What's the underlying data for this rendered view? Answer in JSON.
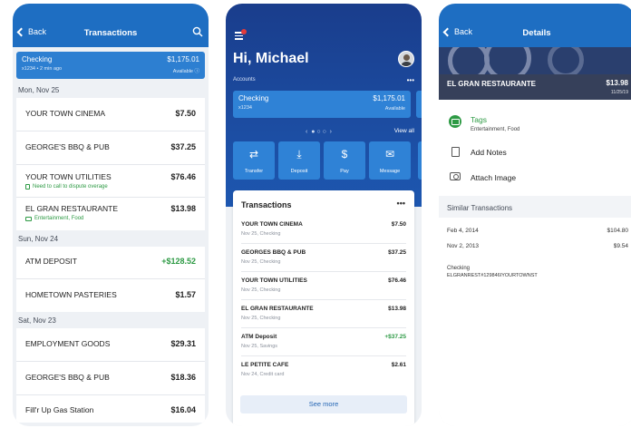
{
  "screen1": {
    "back_label": "Back",
    "title": "Transactions",
    "account": {
      "name": "Checking",
      "sub": "x1234 • 2 min ago",
      "balance": "$1,175.01",
      "available": "Available ⓘ"
    },
    "groups": [
      {
        "date": "Mon, Nov 25",
        "items": [
          {
            "merchant": "YOUR TOWN CINEMA",
            "amount": "$7.50",
            "note": ""
          },
          {
            "merchant": "GEORGE'S BBQ & PUB",
            "amount": "$37.25",
            "note": ""
          },
          {
            "merchant": "YOUR TOWN UTILITIES",
            "amount": "$76.46",
            "note": "Need to call to dispute overage"
          },
          {
            "merchant": "EL GRAN RESTAURANTE",
            "amount": "$13.98",
            "note": "Entertainment, Food"
          }
        ]
      },
      {
        "date": "Sun, Nov 24",
        "items": [
          {
            "merchant": "ATM DEPOSIT",
            "amount": "+$128.52",
            "note": ""
          },
          {
            "merchant": "HOMETOWN PASTERIES",
            "amount": "$1.57",
            "note": ""
          }
        ]
      },
      {
        "date": "Sat, Nov 23",
        "items": [
          {
            "merchant": "EMPLOYMENT GOODS",
            "amount": "$29.31",
            "note": ""
          },
          {
            "merchant": "GEORGE'S BBQ & PUB",
            "amount": "$18.36",
            "note": ""
          },
          {
            "merchant": "Fill'r Up Gas Station",
            "amount": "$16.04",
            "note": ""
          }
        ]
      }
    ]
  },
  "screen2": {
    "greeting": "Hi, Michael",
    "accounts_label": "Accounts",
    "more": "•••",
    "account": {
      "name": "Checking",
      "sub": "x1234",
      "balance": "$1,175.01",
      "available": "Available"
    },
    "view_all": "View all",
    "actions": [
      {
        "label": "Transfer",
        "icon": "transfer-icon"
      },
      {
        "label": "Deposit",
        "icon": "deposit-icon"
      },
      {
        "label": "Pay",
        "icon": "pay-icon"
      },
      {
        "label": "Message",
        "icon": "message-icon"
      }
    ],
    "transactions_title": "Transactions",
    "transactions": [
      {
        "merchant": "YOUR TOWN CINEMA",
        "detail": "Nov 25, Checking",
        "amount": "$7.50"
      },
      {
        "merchant": "GEORGES BBQ & PUB",
        "detail": "Nov 25, Checking",
        "amount": "$37.25"
      },
      {
        "merchant": "YOUR TOWN UTILITIES",
        "detail": "Nov 25, Checking",
        "amount": "$76.46"
      },
      {
        "merchant": "EL GRAN RESTAURANTE",
        "detail": "Nov 25, Checking",
        "amount": "$13.98"
      },
      {
        "merchant": "ATM Deposit",
        "detail": "Nov 25, Savings",
        "amount": "+$37.25"
      },
      {
        "merchant": "LE PETITE CAFE",
        "detail": "Nov 24, Credit card",
        "amount": "$2.61"
      }
    ],
    "see_more": "See more"
  },
  "screen3": {
    "back_label": "Back",
    "title": "Details",
    "merchant": "EL GRAN RESTAURANTE",
    "amount": "$13.98",
    "date": "11/25/19",
    "tags_label": "Tags",
    "tags_value": "Entertainment, Food",
    "add_notes": "Add Notes",
    "attach_image": "Attach Image",
    "similar_label": "Similar Transactions",
    "similar": [
      {
        "date": "Feb 4, 2014",
        "amount": "$104.80"
      },
      {
        "date": "Nov 2, 2013",
        "amount": "$9.54"
      }
    ],
    "raw_account": "Checking",
    "raw_description": "ELGRANREST#129846IYOURTOWNST"
  },
  "colors": {
    "primary": "#1e6ec2",
    "positive": "#2d9a44",
    "hero": "#1a3d8c"
  }
}
